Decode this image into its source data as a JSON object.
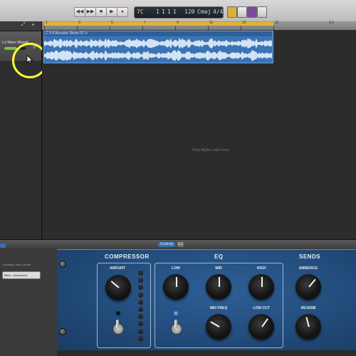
{
  "transport": {
    "buttons": [
      "◀◀",
      "▶▶",
      "■",
      "▶",
      "●"
    ],
    "lcd": {
      "bar": "1",
      "beat": "1",
      "sub": "1",
      "tick": "1",
      "tempo": "120",
      "key": "Cmaj",
      "signature": "4/4",
      "lcd_prefix": "7C"
    }
  },
  "ruler": {
    "marks": [
      "1",
      "3",
      "5",
      "7",
      "9",
      "11",
      "13",
      "15"
    ],
    "end_mark": "9.2"
  },
  "track": {
    "name": "Lo-Wave Mkwell",
    "volume_level": 0.6
  },
  "region": {
    "label": "C 5-9 Acoustic Strum 01 ↻"
  },
  "arrange": {
    "empty_hint": "Drag Apple Loops here."
  },
  "smart_controls": {
    "tab_label": "Controls",
    "info_label": "EQ"
  },
  "left_panel": {
    "title": "Acoustic Lead Control",
    "preset": "Bitch...(dropdown)"
  },
  "plugin": {
    "compressor": {
      "title": "COMPRESSOR",
      "amount_label": "AMOUNT"
    },
    "eq": {
      "title": "EQ",
      "low_label": "LOW",
      "mid_label": "MID",
      "high_label": "HIGH",
      "midfreq_label": "MID FREQ",
      "lowcut_label": "LOW CUT"
    },
    "sends": {
      "title": "SENDS",
      "ambience_label": "AMBIENCE",
      "reverb_label": "REVERB"
    }
  },
  "colors": {
    "cycle": "#e0b436",
    "region": "#3b74b5",
    "plugin_bg": "#214a78",
    "highlight_circle": "#ffff2e",
    "track_level": "#7ec13b",
    "led_blue": "#2a78ff"
  }
}
